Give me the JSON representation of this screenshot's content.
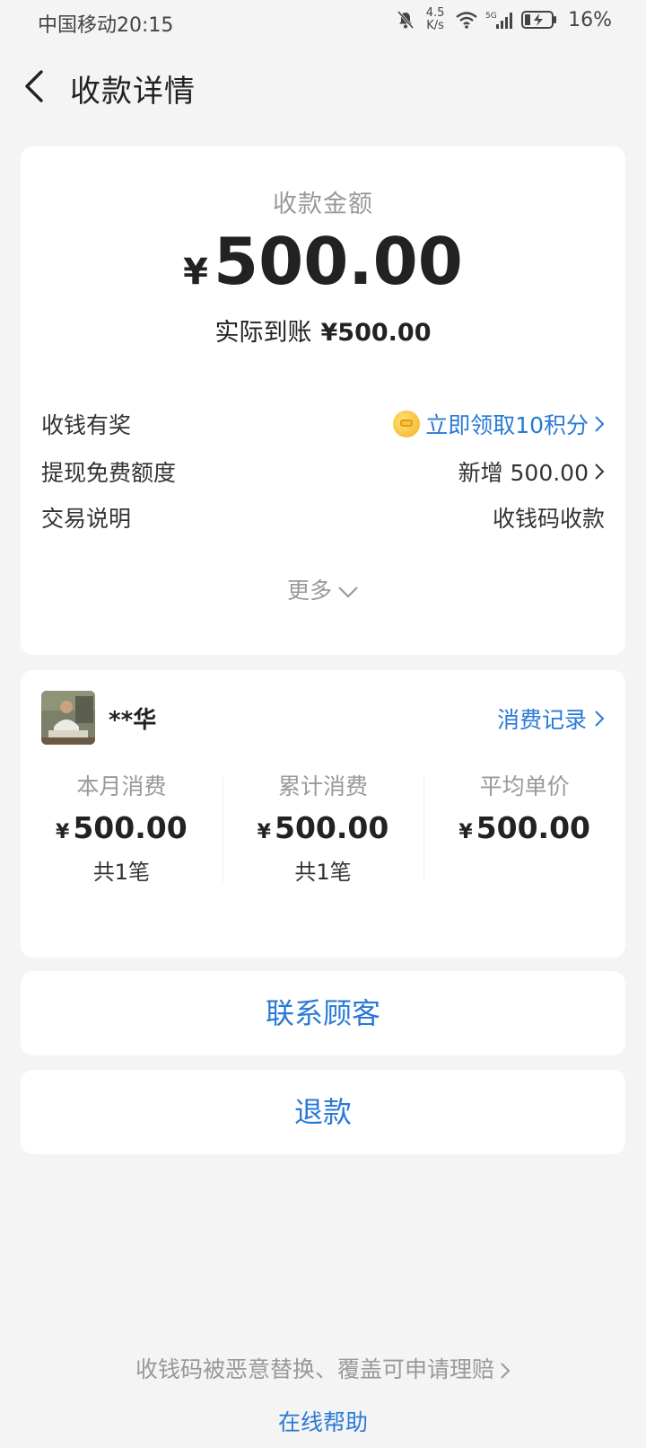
{
  "status_bar": {
    "carrier_time": "中国移动20:15",
    "speed_value": "4.5",
    "speed_unit": "K/s",
    "network": "5G",
    "battery": "16%"
  },
  "nav": {
    "title": "收款详情"
  },
  "amount_card": {
    "label": "收款金额",
    "currency": "¥",
    "amount": "500.00",
    "actual_label": "实际到账",
    "actual_amount": "¥500.00",
    "rows": [
      {
        "label": "收钱有奖",
        "value": "立即领取10积分"
      },
      {
        "label": "提现免费额度",
        "value": "新增 500.00"
      },
      {
        "label": "交易说明",
        "value": "收钱码收款"
      }
    ],
    "more": "更多"
  },
  "customer_card": {
    "name": "**华",
    "records_link": "消费记录",
    "stats": [
      {
        "label": "本月消费",
        "value": "500.00",
        "count": "共1笔"
      },
      {
        "label": "累计消费",
        "value": "500.00",
        "count": "共1笔"
      },
      {
        "label": "平均单价",
        "value": "500.00",
        "count": ""
      }
    ],
    "currency": "¥"
  },
  "actions": {
    "contact": "联系顾客",
    "refund": "退款"
  },
  "footer": {
    "claim": "收钱码被恶意替换、覆盖可申请理赔",
    "help": "在线帮助"
  },
  "colors": {
    "accent": "#2a7ad6",
    "background": "#f4f4f4"
  }
}
